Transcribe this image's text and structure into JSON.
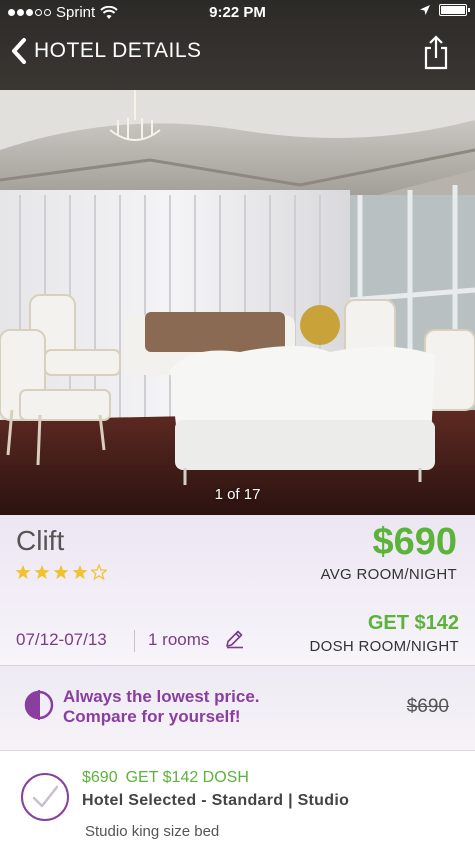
{
  "status_bar": {
    "carrier": "Sprint",
    "time": "9:22 PM"
  },
  "nav": {
    "title": "HOTEL DETAILS",
    "back_icon": "chevron-left-icon",
    "share_icon": "share-icon"
  },
  "photo": {
    "counter": "1 of 17"
  },
  "hotel": {
    "name": "Clift",
    "star_rating": 4,
    "star_max": 5,
    "price": "$690",
    "price_label": "AVG ROOM/NIGHT",
    "dates": "07/12-07/13",
    "rooms": "1 rooms",
    "dosh": "GET $142",
    "dosh_label": "DOSH ROOM/NIGHT"
  },
  "promo": {
    "line1": "Always the lowest price.",
    "line2": "Compare for yourself!",
    "compare_price": "$690"
  },
  "room": {
    "price": "$690",
    "dosh": "GET $142 DOSH",
    "title": "Hotel Selected - Standard | Studio",
    "description": "Studio king size bed"
  },
  "colors": {
    "accent_green": "#5cb33a",
    "accent_purple": "#8a3ea0",
    "header_bg": "#2c2a27"
  }
}
